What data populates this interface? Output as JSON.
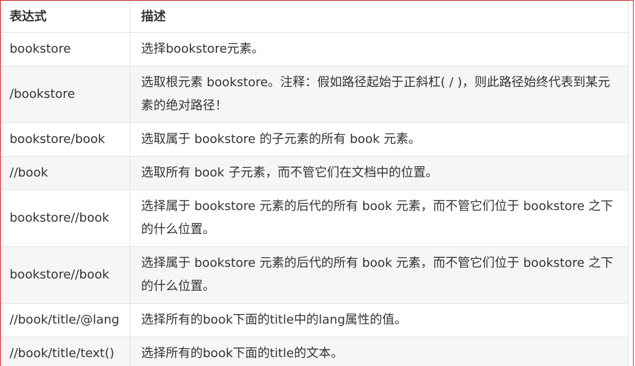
{
  "table": {
    "headers": [
      "表达式",
      "描述"
    ],
    "rows": [
      {
        "expr": "bookstore",
        "desc": "选择bookstore元素。"
      },
      {
        "expr": "/bookstore",
        "desc": "选取根元素 bookstore。注释：假如路径起始于正斜杠( / )，则此路径始终代表到某元素的绝对路径！"
      },
      {
        "expr": "bookstore/book",
        "desc": "选取属于 bookstore 的子元素的所有 book 元素。"
      },
      {
        "expr": "//book",
        "desc": "选取所有 book 子元素，而不管它们在文档中的位置。"
      },
      {
        "expr": "bookstore//book",
        "desc": "选择属于 bookstore 元素的后代的所有 book 元素，而不管它们位于 bookstore 之下的什么位置。"
      },
      {
        "expr": "bookstore//book",
        "desc": "选择属于 bookstore 元素的后代的所有 book 元素，而不管它们位于 bookstore 之下的什么位置。"
      },
      {
        "expr": "//book/title/@lang",
        "desc": "选择所有的book下面的title中的lang属性的值。"
      },
      {
        "expr": "//book/title/text()",
        "desc": "选择所有的book下面的title的文本。"
      }
    ]
  }
}
